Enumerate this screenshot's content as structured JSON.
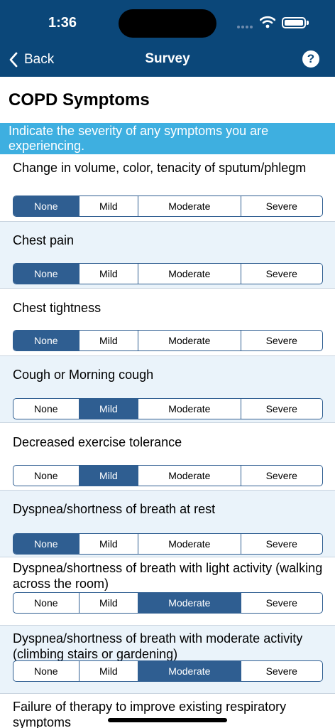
{
  "status_bar": {
    "time": "1:36"
  },
  "nav": {
    "back_label": "Back",
    "title": "Survey",
    "help_label": "?"
  },
  "page": {
    "title": "COPD Symptoms",
    "instruction": "Indicate the severity of any symptoms you are experiencing."
  },
  "options": [
    "None",
    "Mild",
    "Moderate",
    "Severe"
  ],
  "colors": {
    "header": "#0b4779",
    "banner": "#3eafe0",
    "selected": "#2f5e91",
    "alt_row": "#eaf3fa"
  },
  "questions": [
    {
      "label": "Change in volume, color, tenacity of sputum/phlegm",
      "selected": "None"
    },
    {
      "label": "Chest pain",
      "selected": "None"
    },
    {
      "label": "Chest tightness",
      "selected": "None"
    },
    {
      "label": "Cough or Morning cough",
      "selected": "Mild"
    },
    {
      "label": "Decreased exercise tolerance",
      "selected": "Mild"
    },
    {
      "label": "Dyspnea/shortness of breath at rest",
      "selected": "None"
    },
    {
      "label": "Dyspnea/shortness of breath with light activity (walking across the room)",
      "selected": "Moderate"
    },
    {
      "label": "Dyspnea/shortness of breath with moderate activity (climbing stairs or gardening)",
      "selected": "Moderate"
    },
    {
      "label": "Failure of therapy to improve existing respiratory symptoms",
      "selected": ""
    }
  ]
}
